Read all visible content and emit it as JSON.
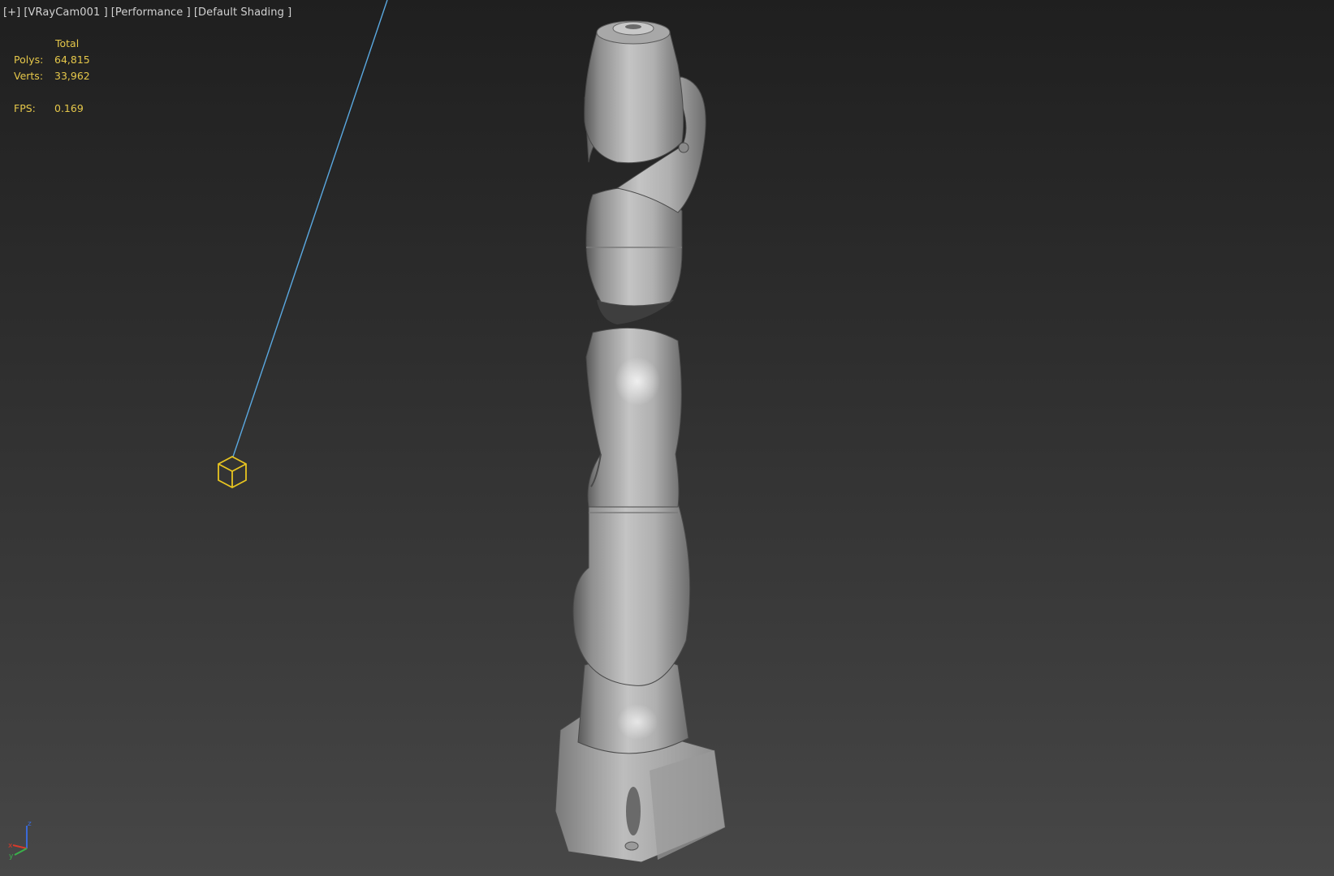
{
  "viewport": {
    "labels": [
      "[+]",
      "[VRayCam001 ]",
      "[Performance ]",
      "[Default Shading ]"
    ]
  },
  "stats": {
    "header": "Total",
    "polys_label": "Polys:",
    "polys_value": "64,815",
    "verts_label": "Verts:",
    "verts_value": "33,962",
    "fps_label": "FPS:",
    "fps_value": "0.169"
  },
  "gizmo": {
    "x_label": "x",
    "y_label": "y",
    "z_label": "z"
  },
  "colors": {
    "stats_text": "#e6c84a",
    "camera_target": "#e8c520",
    "camera_line": "#5aa8e0",
    "axis_x": "#d83a2a",
    "axis_y": "#3ab04a",
    "axis_z": "#3a6ad8"
  },
  "icons": {
    "camera_target": "camera-target-cube-icon",
    "axis": "axis-tripod-icon"
  }
}
